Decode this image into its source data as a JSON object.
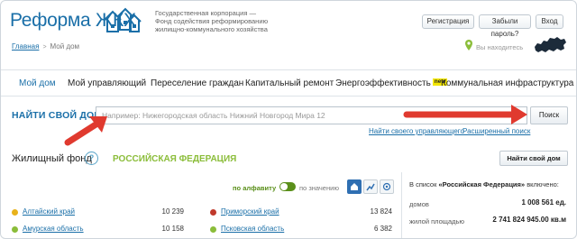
{
  "header": {
    "logo": "Реформа ЖКХ",
    "org_line1": "Государственная корпорация —",
    "org_line2": "Фонд содействия реформированию",
    "org_line3": "жилищно-коммунального хозяйства",
    "buttons": {
      "register": "Регистрация",
      "forgot": "Забыли пароль?",
      "login": "Вход"
    }
  },
  "breadcrumb": {
    "home": "Главная",
    "separator": ">",
    "current": "Мой дом"
  },
  "location": {
    "label": "Вы находитесь"
  },
  "nav": {
    "items": [
      {
        "label": "Мой дом"
      },
      {
        "label": "Мой управляющий"
      },
      {
        "label": "Переселение граждан"
      },
      {
        "label": "Капитальный ремонт"
      },
      {
        "label": "Энергоэффективность"
      },
      {
        "label": "Коммунальная инфраструктура"
      }
    ],
    "new_badge": "new"
  },
  "search": {
    "title": "НАЙТИ СВОЙ ДОМ",
    "placeholder": "Например: Нижегородская область Нижний Новгород Мира 12",
    "button": "Поиск",
    "link_manager": "Найти своего управляющего",
    "link_advanced": "Расширенный поиск"
  },
  "fund": {
    "title": "Жилищный фонд",
    "help": "?",
    "region": "РОССИЙСКАЯ ФЕДЕРАЦИЯ",
    "your_house_button": "Найти свой дом",
    "sort_alpha": "по алфавиту",
    "sort_value": "по значению",
    "regions_left": [
      {
        "name": "Алтайский край",
        "value": "10 239",
        "color": "#e8b21b"
      },
      {
        "name": "Амурская область",
        "value": "10 158",
        "color": "#8bbd3a"
      }
    ],
    "regions_right": [
      {
        "name": "Приморский край",
        "value": "13 824",
        "color": "#c0392b"
      },
      {
        "name": "Псковская область",
        "value": "6 382",
        "color": "#8bbd3a"
      }
    ]
  },
  "stats": {
    "head_prefix": "В список",
    "head_region": "«Российская Федерация»",
    "head_suffix": "включено:",
    "rows": [
      {
        "label": "домов",
        "value": "1 008 561 ед."
      },
      {
        "label": "жилой площадью",
        "value": "2 741 824 945.00 кв.м"
      }
    ]
  },
  "colors": {
    "accent": "#1a6fa8",
    "green": "#8bbd3a",
    "arrow": "#e03a2f"
  },
  "icons": [
    "houses-logo-icon",
    "location-pin-icon",
    "russia-map-icon",
    "help-icon",
    "home-view-icon",
    "chart-view-icon",
    "map-view-icon"
  ]
}
